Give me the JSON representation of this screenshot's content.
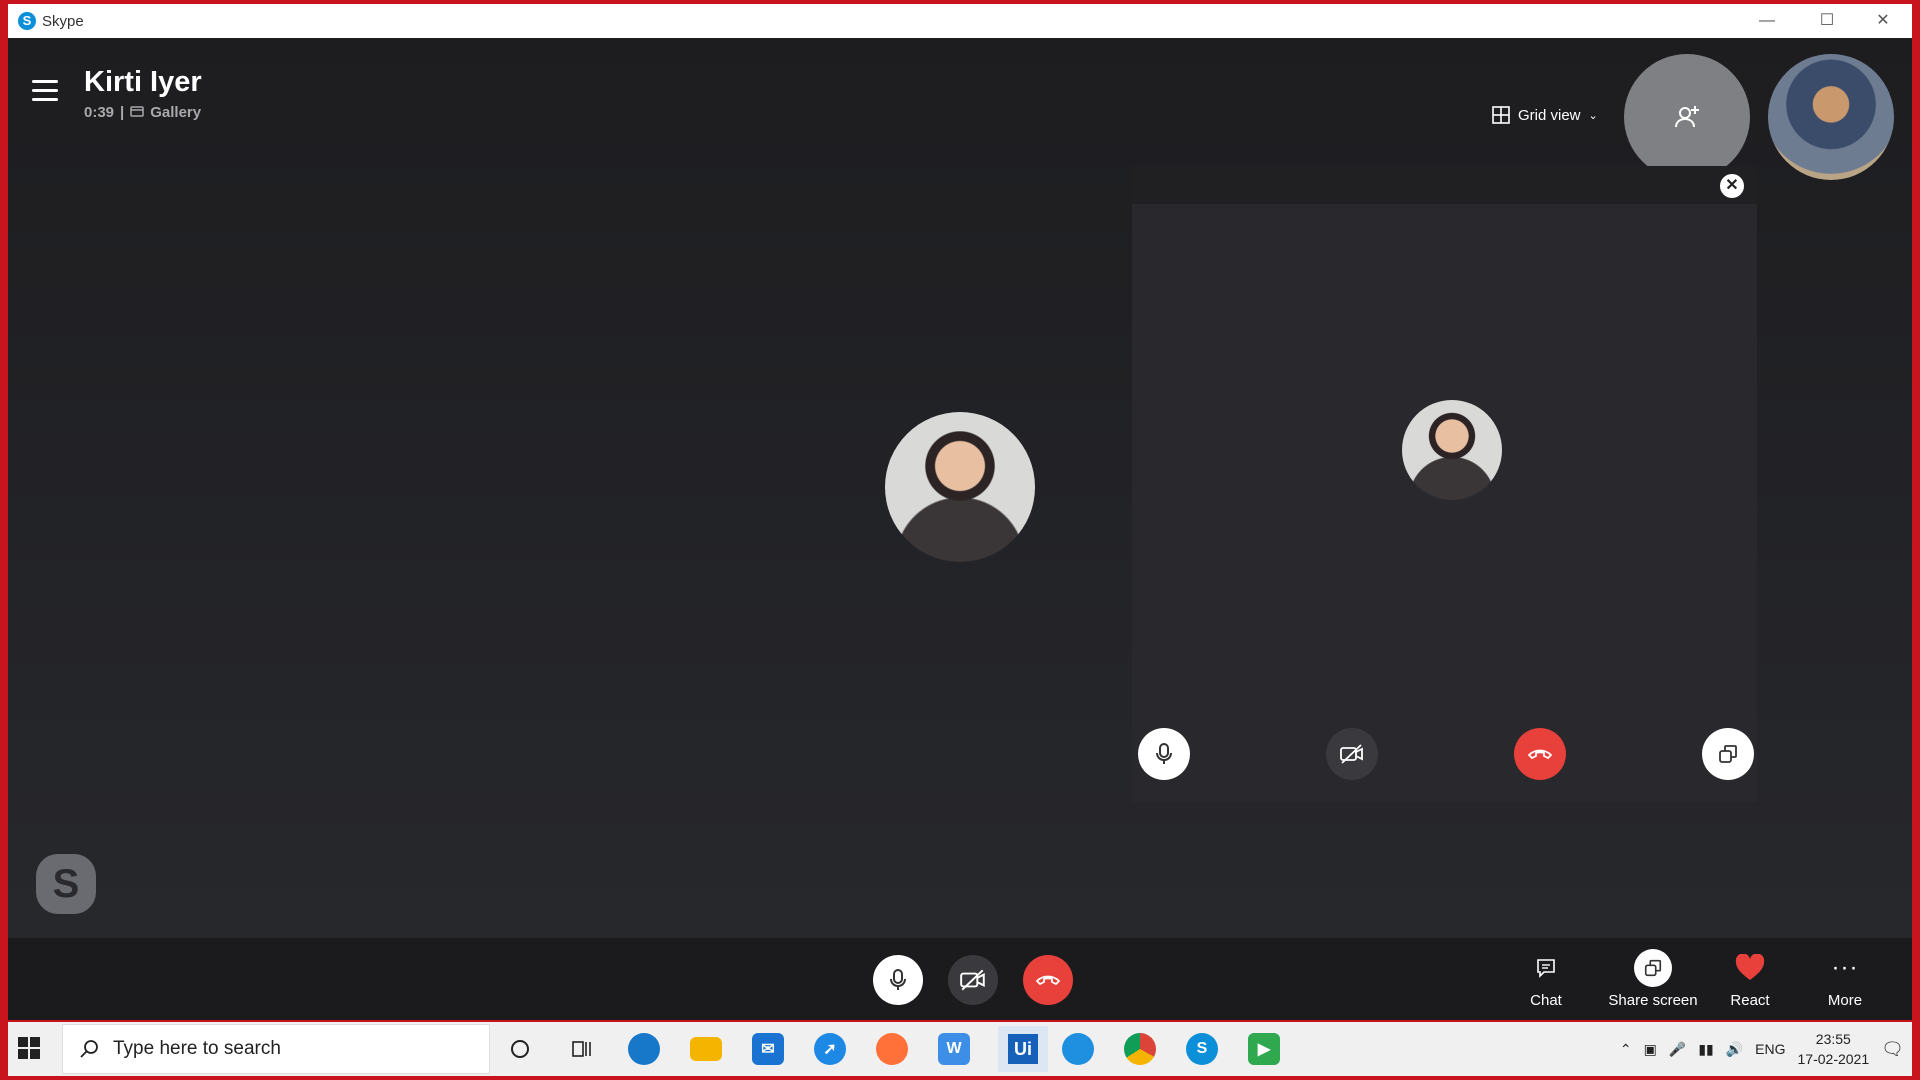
{
  "window": {
    "title": "Skype",
    "app_icon_letter": "S"
  },
  "call": {
    "callee_name": "Kirti Iyer",
    "duration": "0:39",
    "separator": "|",
    "view_label": "Gallery"
  },
  "header": {
    "grid_view_label": "Grid view"
  },
  "bottom_actions": {
    "chat": "Chat",
    "share_screen": "Share screen",
    "react": "React",
    "more": "More"
  },
  "watermark": {
    "letter": "S"
  },
  "taskbar": {
    "search_placeholder": "Type here to search",
    "apps": [
      "Cortana",
      "Task View",
      "Microsoft Edge",
      "File Explorer",
      "Mail",
      "App",
      "Firefox",
      "App",
      "UiPath",
      "App",
      "Chrome",
      "Skype",
      "Camtasia"
    ],
    "uipath_label": "Ui",
    "skype_label": "S",
    "tray": {
      "language": "ENG",
      "time": "23:55",
      "date": "17-02-2021"
    }
  },
  "colors": {
    "red": "#e8403a",
    "accent": "#0a8fd8",
    "react_heart": "#e8403a"
  }
}
